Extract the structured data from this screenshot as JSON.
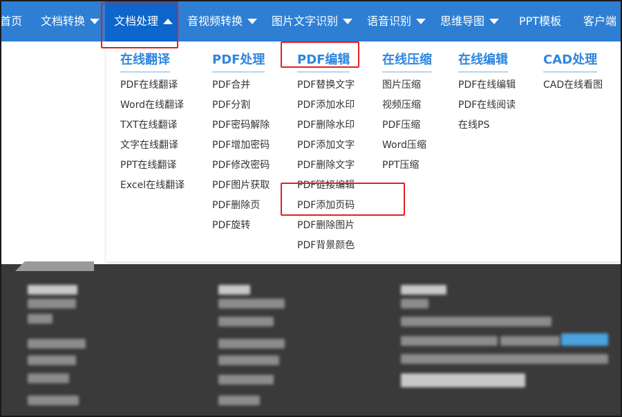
{
  "nav": {
    "items": [
      {
        "label": "首页",
        "caret": false
      },
      {
        "label": "文档转换",
        "caret": true
      },
      {
        "label": "文档处理",
        "caret": true,
        "active": true
      },
      {
        "label": "音视频转换",
        "caret": true
      },
      {
        "label": "图片文字识别",
        "caret": true
      },
      {
        "label": "语音识别",
        "caret": true
      },
      {
        "label": "思维导图",
        "caret": true
      },
      {
        "label": "PPT模板",
        "caret": false
      },
      {
        "label": "客户端",
        "caret": false
      }
    ]
  },
  "dropdown": {
    "columns": [
      {
        "title": "在线翻译",
        "items": [
          "PDF在线翻译",
          "Word在线翻译",
          "TXT在线翻译",
          "文字在线翻译",
          "PPT在线翻译",
          "Excel在线翻译"
        ]
      },
      {
        "title": "PDF处理",
        "items": [
          "PDF合并",
          "PDF分割",
          "PDF密码解除",
          "PDF增加密码",
          "PDF修改密码",
          "PDF图片获取",
          "PDF删除页",
          "PDF旋转"
        ]
      },
      {
        "title": "PDF编辑",
        "items": [
          "PDF替换文字",
          "PDF添加水印",
          "PDF删除水印",
          "PDF添加文字",
          "PDF删除文字",
          "PDF链接编辑",
          "PDF添加页码",
          "PDF删除图片",
          "PDF背景颜色"
        ]
      },
      {
        "title": "在线压缩",
        "items": [
          "图片压缩",
          "视频压缩",
          "PDF压缩",
          "Word压缩",
          "PPT压缩"
        ]
      },
      {
        "title": "在线编辑",
        "items": [
          "PDF在线编辑",
          "PDF在线阅读",
          "在线PS"
        ]
      },
      {
        "title": "CAD处理",
        "items": [
          "CAD在线看图"
        ]
      }
    ]
  },
  "colors": {
    "nav_bg": "#2e7fd4",
    "nav_active": "#0d66cc",
    "title": "#2e86de",
    "highlight": "#e02020"
  }
}
